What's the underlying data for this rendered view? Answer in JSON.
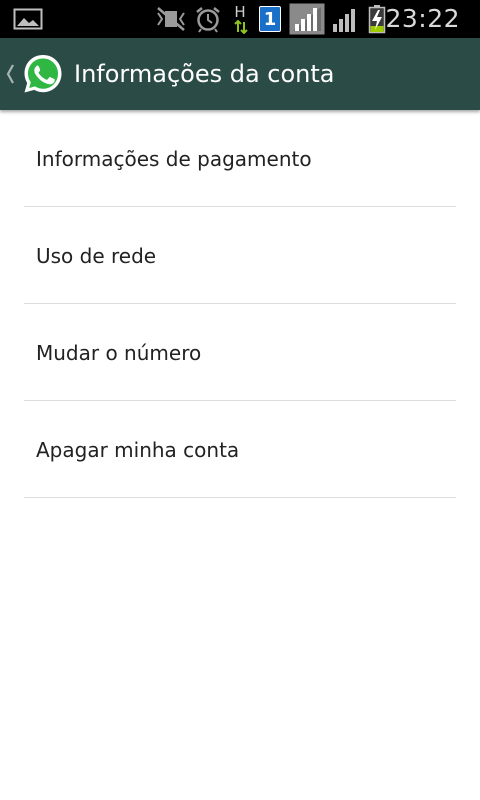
{
  "status_bar": {
    "time": "23:22",
    "icons": [
      "gallery-icon",
      "mute-icon",
      "alarm-icon",
      "network-h-icon",
      "sim-1-icon",
      "signal-strong-icon",
      "signal-icon",
      "battery-charging-icon"
    ],
    "network_type": "H",
    "sim_number": "1"
  },
  "action_bar": {
    "title": "Informações da conta",
    "icons": [
      "back-chevron-icon",
      "whatsapp-logo-icon"
    ]
  },
  "settings": {
    "items": [
      {
        "label": "Informações de pagamento"
      },
      {
        "label": "Uso de rede"
      },
      {
        "label": "Mudar o número"
      },
      {
        "label": "Apagar minha conta"
      }
    ]
  },
  "colors": {
    "status_bar_bg": "#000000",
    "action_bar_bg": "#2b4c46",
    "whatsapp_green": "#2fb643",
    "list_text": "#222222",
    "divider": "#dcdcdc",
    "battery_charge": "#9ccc00",
    "sim_badge": "#1a6fc9"
  }
}
